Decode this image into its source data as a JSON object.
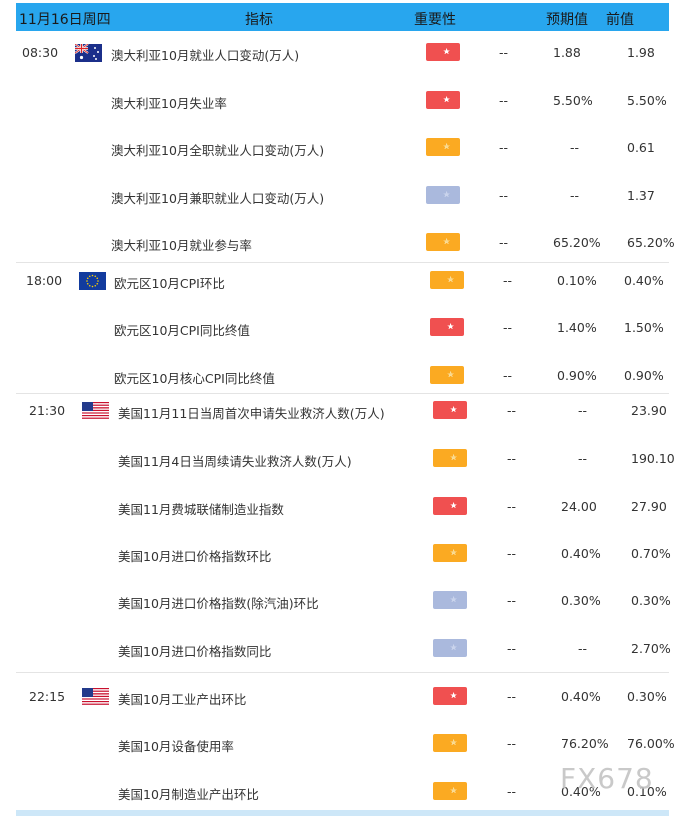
{
  "header": {
    "date": "11月16日周四",
    "indicator": "指标",
    "importance": "重要性",
    "forecast": "预期值",
    "previous": "前值"
  },
  "rows": [
    {
      "time": "08:30",
      "flag": "australia",
      "name": "澳大利亚10月就业人口变动(万人)",
      "importance": 3,
      "actual": "--",
      "forecast": "1.88",
      "previous": "1.98"
    },
    {
      "time": "",
      "flag": "",
      "name": "澳大利亚10月失业率",
      "importance": 3,
      "actual": "--",
      "forecast": "5.50%",
      "previous": "5.50%"
    },
    {
      "time": "",
      "flag": "",
      "name": "澳大利亚10月全职就业人口变动(万人)",
      "importance": 2,
      "actual": "--",
      "forecast": "--",
      "previous": "0.61"
    },
    {
      "time": "",
      "flag": "",
      "name": "澳大利亚10月兼职就业人口变动(万人)",
      "importance": 1,
      "actual": "--",
      "forecast": "--",
      "previous": "1.37"
    },
    {
      "time": "",
      "flag": "",
      "name": "澳大利亚10月就业参与率",
      "importance": 2,
      "actual": "--",
      "forecast": "65.20%",
      "previous": "65.20%"
    },
    {
      "time": "18:00",
      "flag": "eu",
      "name": "欧元区10月CPI环比",
      "importance": 2,
      "actual": "--",
      "forecast": "0.10%",
      "previous": "0.40%"
    },
    {
      "time": "",
      "flag": "",
      "name": "欧元区10月CPI同比终值",
      "importance": 3,
      "actual": "--",
      "forecast": "1.40%",
      "previous": "1.50%"
    },
    {
      "time": "",
      "flag": "",
      "name": "欧元区10月核心CPI同比终值",
      "importance": 2,
      "actual": "--",
      "forecast": "0.90%",
      "previous": "0.90%"
    },
    {
      "time": "21:30",
      "flag": "usa",
      "name": "美国11月11日当周首次申请失业救济人数(万人)",
      "importance": 3,
      "actual": "--",
      "forecast": "--",
      "previous": "23.90"
    },
    {
      "time": "",
      "flag": "",
      "name": "美国11月4日当周续请失业救济人数(万人)",
      "importance": 2,
      "actual": "--",
      "forecast": "--",
      "previous": "190.10"
    },
    {
      "time": "",
      "flag": "",
      "name": "美国11月费城联储制造业指数",
      "importance": 3,
      "actual": "--",
      "forecast": "24.00",
      "previous": "27.90"
    },
    {
      "time": "",
      "flag": "",
      "name": "美国10月进口价格指数环比",
      "importance": 2,
      "actual": "--",
      "forecast": "0.40%",
      "previous": "0.70%"
    },
    {
      "time": "",
      "flag": "",
      "name": "美国10月进口价格指数(除汽油)环比",
      "importance": 1,
      "actual": "--",
      "forecast": "0.30%",
      "previous": "0.30%"
    },
    {
      "time": "",
      "flag": "",
      "name": "美国10月进口价格指数同比",
      "importance": 1,
      "actual": "--",
      "forecast": "--",
      "previous": "2.70%"
    },
    {
      "time": "22:15",
      "flag": "usa",
      "name": "美国10月工业产出环比",
      "importance": 3,
      "actual": "--",
      "forecast": "0.40%",
      "previous": "0.30%"
    },
    {
      "time": "",
      "flag": "",
      "name": "美国10月设备使用率",
      "importance": 2,
      "actual": "--",
      "forecast": "76.20%",
      "previous": "76.00%"
    },
    {
      "time": "",
      "flag": "",
      "name": "美国10月制造业产出环比",
      "importance": 2,
      "actual": "--",
      "forecast": "0.40%",
      "previous": "0.10%"
    }
  ],
  "watermark": "FX678",
  "colors": {
    "header": "#28a6ee",
    "high": "#f05050",
    "medium": "#fbaa22",
    "low": "#aab9dd"
  }
}
